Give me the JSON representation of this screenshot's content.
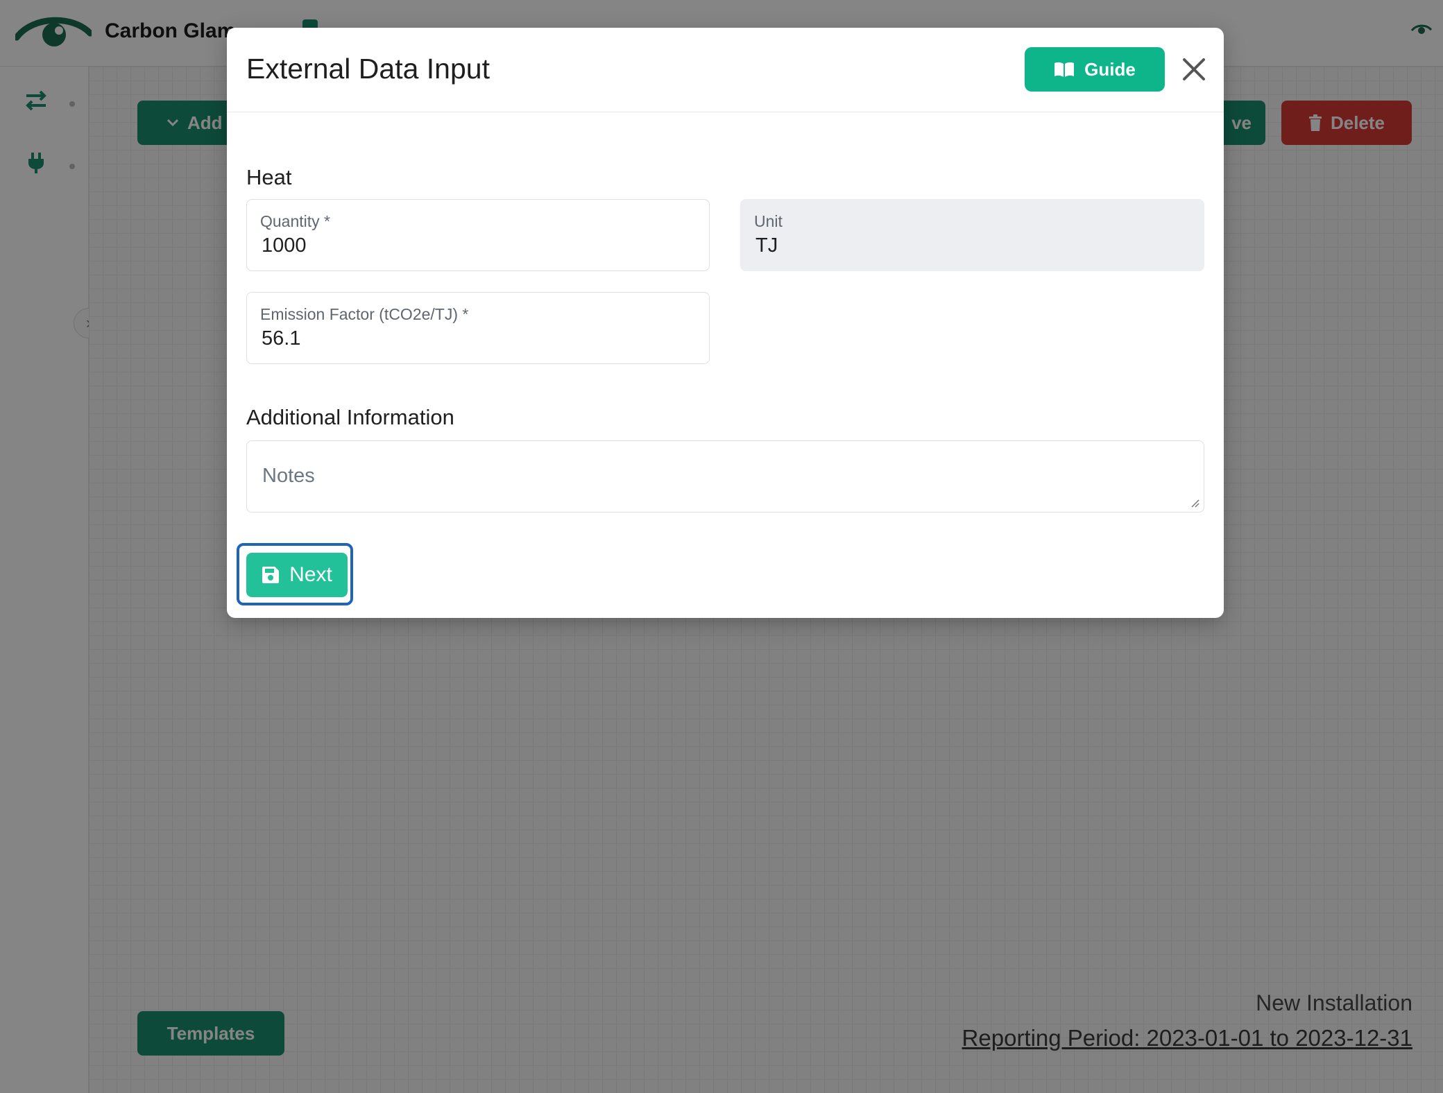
{
  "header": {
    "brand": "Carbon Glam"
  },
  "toolbar": {
    "add_label": "Add",
    "save_label": "ve",
    "delete_label": "Delete"
  },
  "footer": {
    "templates_label": "Templates",
    "installation_name": "New Installation",
    "reporting_period": "Reporting Period: 2023-01-01 to 2023-12-31"
  },
  "modal": {
    "title": "External Data Input",
    "guide_label": "Guide",
    "heat_section": "Heat",
    "quantity": {
      "label": "Quantity *",
      "value": "1000"
    },
    "unit": {
      "label": "Unit",
      "value": "TJ"
    },
    "emission_factor": {
      "label": "Emission Factor (tCO2e/TJ) *",
      "value": "56.1"
    },
    "additional_section": "Additional Information",
    "notes_placeholder": "Notes",
    "next_label": "Next"
  },
  "colors": {
    "primary": "#1a8f6e",
    "guide": "#0fb58a",
    "next": "#22c19a",
    "danger": "#d63a34",
    "focus": "#1e64b8"
  },
  "icons": {
    "logo": "eye-logo-icon",
    "rail_1": "swap-arrows-icon",
    "rail_2": "plug-icon",
    "guide": "book-icon",
    "close": "close-icon",
    "next": "floppy-disk-icon",
    "delete": "trash-icon",
    "add": "chevron-down-icon"
  }
}
